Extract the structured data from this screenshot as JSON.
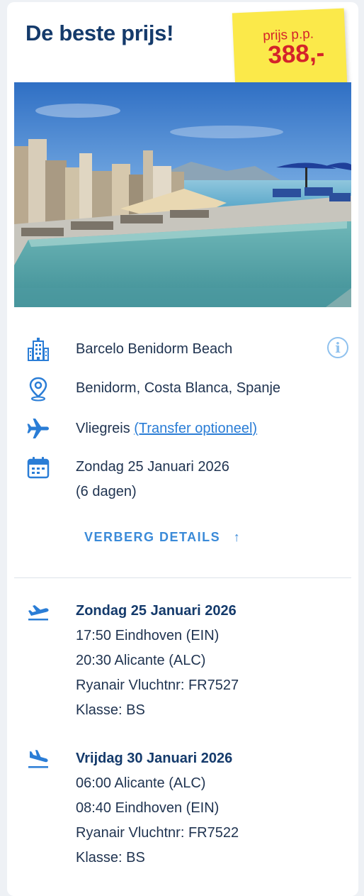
{
  "header": {
    "title": "De beste prijs!"
  },
  "price": {
    "label": "prijs p.p.",
    "value": "388,-"
  },
  "hotel": {
    "name": "Barcelo Benidorm Beach",
    "location": "Benidorm, Costa Blanca, Spanje",
    "travel_type": "Vliegreis",
    "transfer_link": "(Transfer optioneel)",
    "date": "Zondag 25 Januari 2026",
    "duration": "(6 dagen)"
  },
  "details_toggle": {
    "label": "VERBERG DETAILS",
    "arrow": "↑"
  },
  "flights": [
    {
      "date": "Zondag 25 Januari 2026",
      "departure": "17:50 Eindhoven (EIN)",
      "arrival": "20:30 Alicante (ALC)",
      "flight": "Ryanair Vluchtnr: FR7527",
      "class": "Klasse: BS"
    },
    {
      "date": "Vrijdag 30 Januari 2026",
      "departure": "06:00 Alicante (ALC)",
      "arrival": "08:40 Eindhoven (EIN)",
      "flight": "Ryanair Vluchtnr: FR7522",
      "class": "Klasse: BS"
    }
  ],
  "colors": {
    "brand_navy": "#143a6b",
    "accent_blue": "#2a7dd6",
    "price_red": "#d4232a",
    "sticker_yellow": "#fbe94a"
  },
  "icons": [
    "hotel-building-icon",
    "location-pin-icon",
    "airplane-icon",
    "calendar-icon",
    "info-icon",
    "flight-departure-icon",
    "flight-arrival-icon"
  ]
}
